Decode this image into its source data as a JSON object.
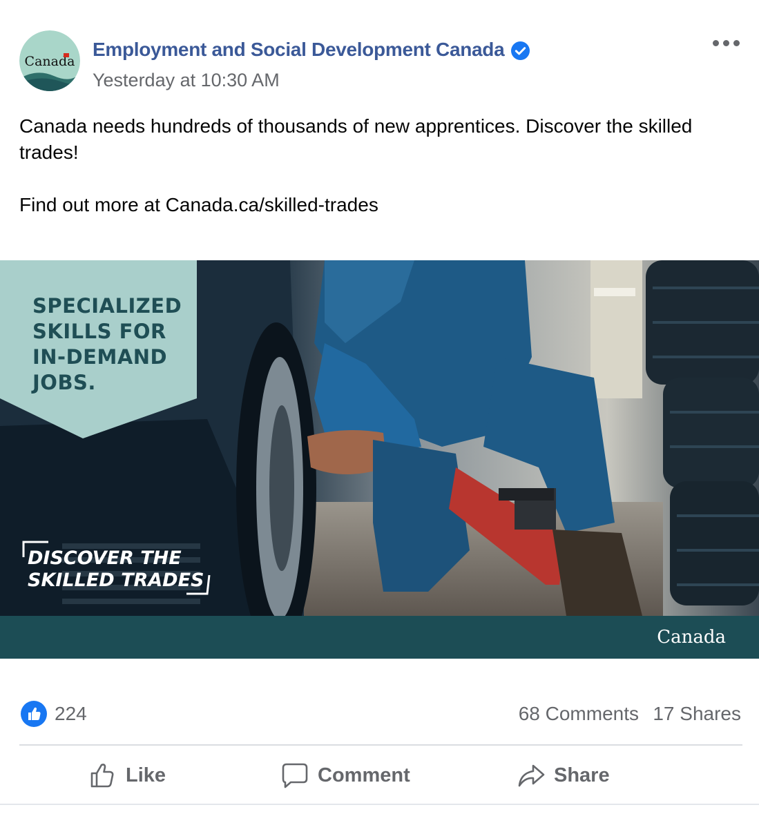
{
  "post": {
    "page_name": "Employment and Social Development Canada",
    "timestamp": "Yesterday at 10:30 AM",
    "avatar_wordmark": "Canada",
    "text_line1": "Canada needs hundreds of thousands of new apprentices. Discover the skilled trades!",
    "text_line2": "Find out more at Canada.ca/skilled-trades",
    "verified_icon": "verified-check-icon",
    "more_icon": "more-horizontal-icon"
  },
  "image": {
    "headline": [
      "SPECIALIZED",
      "SKILLS FOR",
      "IN-DEMAND",
      "JOBS."
    ],
    "tagline": [
      "DISCOVER THE",
      "SKILLED TRADES"
    ],
    "footer_wordmark": "Canada",
    "colors": {
      "banner": "#a9cfcb",
      "headline": "#1f4e55",
      "footer": "#1c4d55"
    }
  },
  "stats": {
    "likes": "224",
    "comments": "68 Comments",
    "shares": "17 Shares"
  },
  "actions": {
    "like": "Like",
    "comment": "Comment",
    "share": "Share"
  },
  "colors": {
    "link": "#3b5998",
    "verified": "#1877f2",
    "muted": "#65676b"
  }
}
